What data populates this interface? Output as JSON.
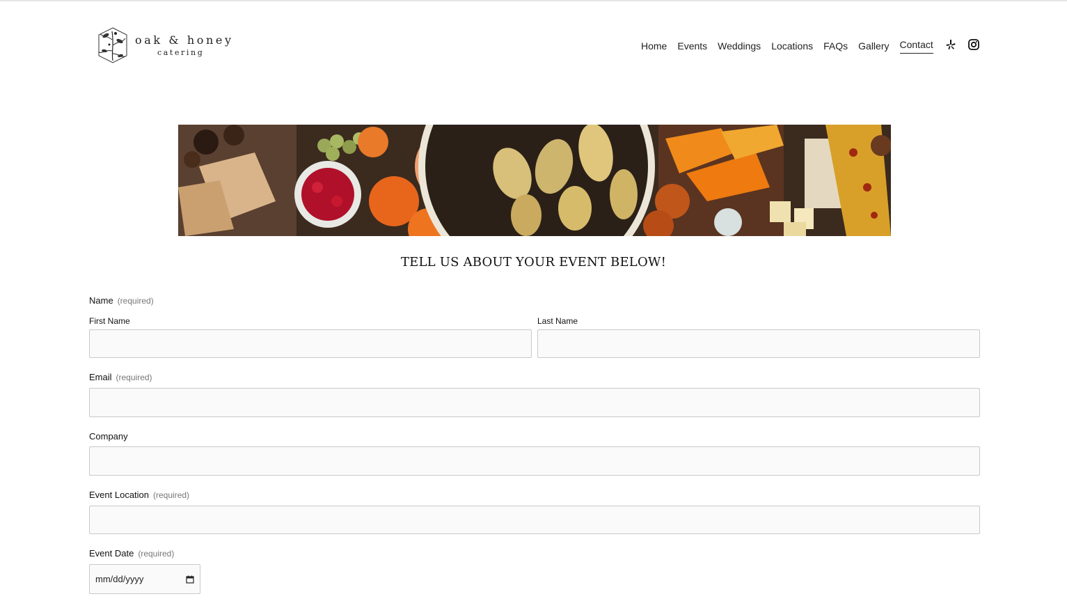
{
  "brand": {
    "name": "oak & honey",
    "sub": "catering"
  },
  "nav": {
    "items": [
      {
        "label": "Home",
        "name": "nav-home",
        "active": false
      },
      {
        "label": "Events",
        "name": "nav-events",
        "active": false
      },
      {
        "label": "Weddings",
        "name": "nav-weddings",
        "active": false
      },
      {
        "label": "Locations",
        "name": "nav-locations",
        "active": false
      },
      {
        "label": "FAQs",
        "name": "nav-faqs",
        "active": false
      },
      {
        "label": "Gallery",
        "name": "nav-gallery",
        "active": false
      },
      {
        "label": "Contact",
        "name": "nav-contact",
        "active": true
      }
    ],
    "social": [
      {
        "icon": "yelp-icon"
      },
      {
        "icon": "instagram-icon"
      }
    ]
  },
  "heading": "TELL US ABOUT YOUR EVENT BELOW!",
  "form": {
    "name_label": "Name",
    "required": "(required)",
    "first_name_label": "First Name",
    "last_name_label": "Last Name",
    "email_label": "Email",
    "company_label": "Company",
    "event_location_label": "Event Location",
    "event_date_label": "Event Date",
    "date_placeholder": "mm/dd/yyyy"
  },
  "colors": {
    "text": "#1a1a1a",
    "field_bg": "#fafafa",
    "field_border": "#c9c9c9",
    "muted": "#777777"
  }
}
